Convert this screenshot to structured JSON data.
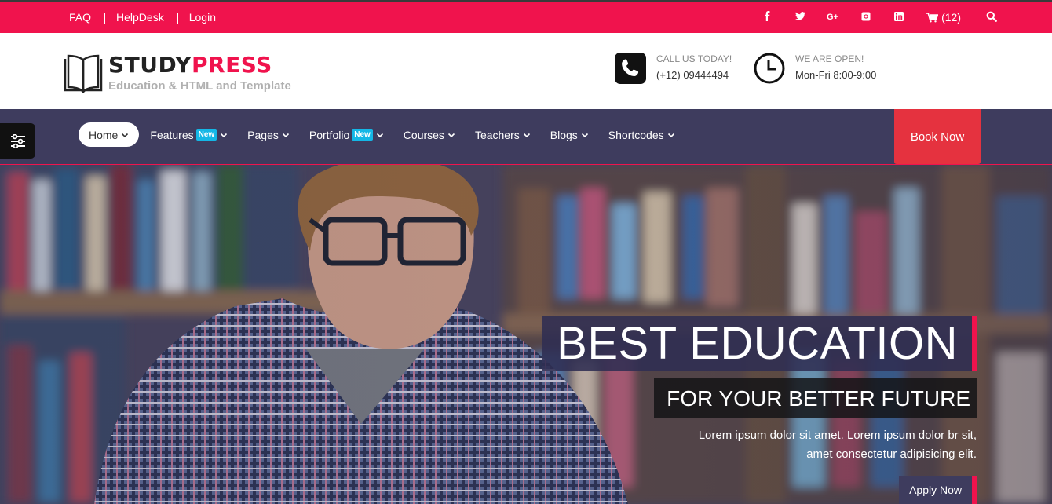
{
  "topbar": {
    "links": [
      "FAQ",
      "HelpDesk",
      "Login"
    ],
    "social_icons": [
      "facebook-icon",
      "twitter-icon",
      "google-plus-icon",
      "instagram-icon",
      "linkedin-icon"
    ],
    "cart_count": "(12)",
    "background": "#f0134d"
  },
  "header": {
    "brand_part1": "STUDY",
    "brand_part2": "PRESS",
    "tagline": "Education & HTML and Template",
    "call_label": "CALL US TODAY!",
    "call_value": "(+12) 09444494",
    "open_label": "WE ARE OPEN!",
    "open_value": "Mon-Fri 8:00-9:00"
  },
  "nav": {
    "items": [
      {
        "label": "Home",
        "badge": ""
      },
      {
        "label": "Features",
        "badge": "New"
      },
      {
        "label": "Pages",
        "badge": ""
      },
      {
        "label": "Portfolio",
        "badge": "New"
      },
      {
        "label": "Courses",
        "badge": ""
      },
      {
        "label": "Teachers",
        "badge": ""
      },
      {
        "label": "Blogs",
        "badge": ""
      },
      {
        "label": "Shortcodes",
        "badge": ""
      }
    ],
    "book_label": "Book Now",
    "background": "#3e3c5e",
    "accent": "#f0134d"
  },
  "hero": {
    "title": "BEST EDUCATION",
    "subtitle": "FOR YOUR BETTER FUTURE",
    "desc_line1": "Lorem ipsum dolor sit amet. Lorem ipsum dolor br sit,",
    "desc_line2": "amet consectetur adipisicing elit.",
    "button": "Apply Now"
  }
}
